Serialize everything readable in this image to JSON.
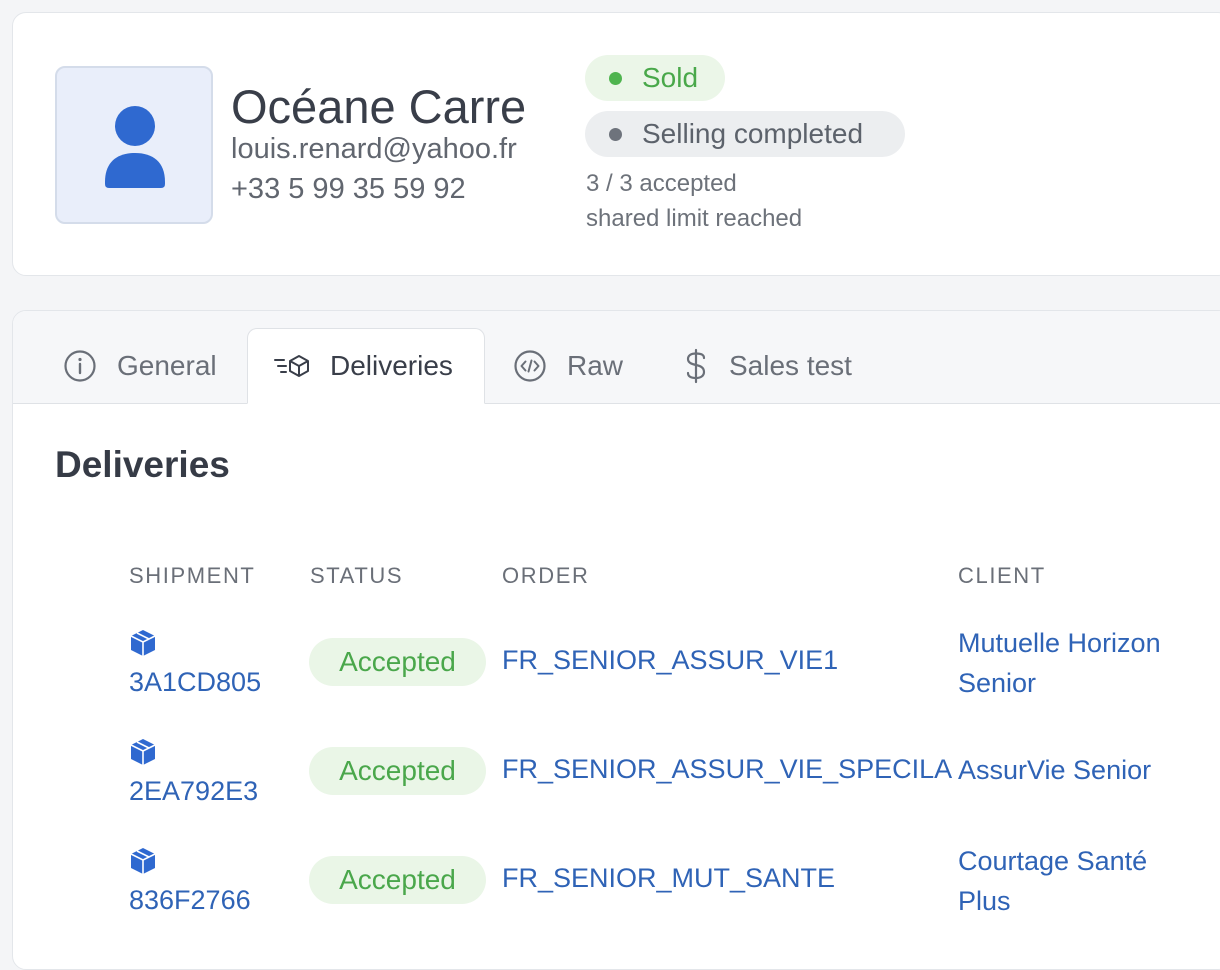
{
  "profile": {
    "name": "Océane Carre",
    "email": "louis.renard@yahoo.fr",
    "phone": "+33 5 99 35 59 92",
    "avatar_icon": "user-icon",
    "status_badge": "Sold",
    "status_badge_color": "#4fb44f",
    "selling_badge": "Selling completed",
    "selling_badge_color": "#6e737c",
    "accepted_count": "3 / 3 accepted",
    "limit_text": "shared limit reached"
  },
  "tabs": [
    {
      "label": "General",
      "icon": "info-circle-icon"
    },
    {
      "label": "Deliveries",
      "icon": "delivery-box-icon",
      "active": true
    },
    {
      "label": "Raw",
      "icon": "code-icon"
    },
    {
      "label": "Sales test",
      "icon": "dollar-icon"
    }
  ],
  "deliveries": {
    "title": "Deliveries",
    "columns": {
      "shipment": "SHIPMENT",
      "status": "STATUS",
      "order": "ORDER",
      "client": "CLIENT"
    },
    "rows": [
      {
        "shipment": "3A1CD805",
        "status": "Accepted",
        "order": "FR_SENIOR_ASSUR_VIE1",
        "client_line1": "Mutuelle Horizon",
        "client_line2": "Senior"
      },
      {
        "shipment": "2EA792E3",
        "status": "Accepted",
        "order": "FR_SENIOR_ASSUR_VIE_SPECILA",
        "client_line1": "AssurVie Senior",
        "client_line2": ""
      },
      {
        "shipment": "836F2766",
        "status": "Accepted",
        "order": "FR_SENIOR_MUT_SANTE",
        "client_line1": "Courtage Santé",
        "client_line2": "Plus"
      }
    ]
  },
  "colors": {
    "link": "#2f63b6",
    "accepted": "#4aa74b",
    "accepted_bg": "#eaf6e7"
  }
}
